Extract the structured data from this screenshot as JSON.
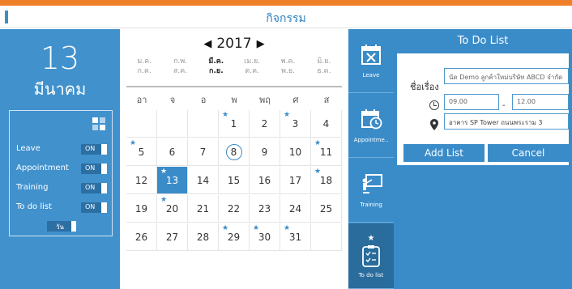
{
  "header": {
    "title": "กิจกรรม"
  },
  "colors": {
    "accent": "#f07f2a",
    "brand_blue": "#3a8cc9",
    "left_panel": "#4191cd"
  },
  "left": {
    "day": "13",
    "month": "มีนาคม",
    "filters": [
      {
        "label": "Leave",
        "state": "ON"
      },
      {
        "label": "Appointment",
        "state": "ON"
      },
      {
        "label": "Training",
        "state": "ON"
      },
      {
        "label": "To do list",
        "state": "ON"
      }
    ],
    "view_toggle": "วัน"
  },
  "calendar": {
    "year": "2017",
    "prev_icon": "caret-left-icon",
    "next_icon": "caret-right-icon",
    "months": [
      {
        "top": "ม.ค.",
        "bottom": "ก.ค."
      },
      {
        "top": "ก.พ.",
        "bottom": "ส.ค."
      },
      {
        "top": "มี.ค.",
        "bottom": "ก.ย."
      },
      {
        "top": "เม.ย.",
        "bottom": "ต.ค."
      },
      {
        "top": "พ.ค.",
        "bottom": "พ.ย."
      },
      {
        "top": "มิ.ย.",
        "bottom": "ธ.ค."
      }
    ],
    "selected_month": 2,
    "weekdays": [
      "อา",
      "จ",
      "อ",
      "พ",
      "พฤ",
      "ศ",
      "ส"
    ],
    "weeks": [
      [
        "",
        "",
        "",
        "1",
        "2",
        "3",
        "4"
      ],
      [
        "5",
        "6",
        "7",
        "8",
        "9",
        "10",
        "11"
      ],
      [
        "12",
        "13",
        "14",
        "15",
        "16",
        "17",
        "18"
      ],
      [
        "19",
        "20",
        "21",
        "22",
        "23",
        "24",
        "25"
      ],
      [
        "26",
        "27",
        "28",
        "29",
        "30",
        "31",
        ""
      ]
    ],
    "starred_days": [
      "1",
      "3",
      "5",
      "11",
      "13",
      "18",
      "20",
      "29",
      "30",
      "31"
    ],
    "selected_day": "13",
    "today": "8"
  },
  "tabs": [
    {
      "label": "Leave",
      "icon": "calendar-x-icon"
    },
    {
      "label": "Appointme..",
      "icon": "calendar-clock-icon"
    },
    {
      "label": "Training",
      "icon": "presentation-icon"
    },
    {
      "label": "To do list",
      "icon": "clipboard-check-icon"
    }
  ],
  "active_tab": "To do list",
  "todo": {
    "title": "To Do List",
    "subject_label": "ชื่อเรื่อง",
    "subject_value": "นัด Demo ลูกค้าใหม่บริษัท ABCD จำกัด",
    "time_start": "09.00",
    "time_end": "12.00",
    "time_separator": "-",
    "location": "อาคาร SP Tower ถนนพระราม 3",
    "add_label": "Add List",
    "cancel_label": "Cancel"
  }
}
